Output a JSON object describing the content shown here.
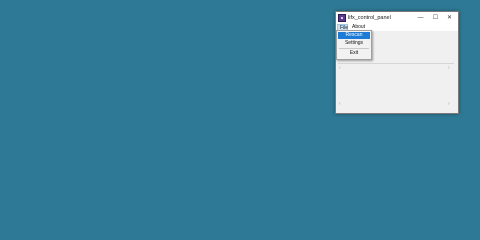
{
  "window": {
    "title": "lifx_control_panel",
    "minimize_glyph": "—",
    "maximize_glyph": "☐",
    "close_glyph": "✕"
  },
  "menubar": {
    "file_label": "File",
    "about_label": "About"
  },
  "file_menu": {
    "items": [
      {
        "label": "Rescan",
        "state": "highlighted"
      },
      {
        "label": "Settings"
      },
      {
        "label": "Exit"
      }
    ]
  },
  "panels": {
    "scroll_left_glyph": "‹",
    "scroll_right_glyph": "›"
  },
  "colors": {
    "desktop": "#2e7a96",
    "highlight": "#1b7bd6",
    "window_bg": "#f0f0f0"
  }
}
